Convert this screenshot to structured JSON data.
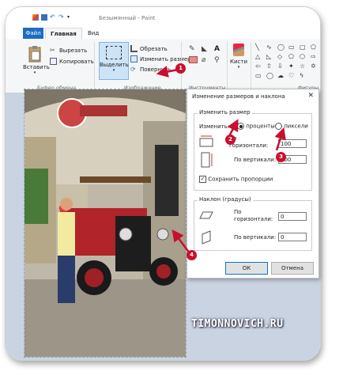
{
  "app": {
    "title": "Безымянный - Paint"
  },
  "menu": {
    "file": "Файл",
    "home": "Главная",
    "view": "Вид"
  },
  "clipboard": {
    "paste": "Вставить",
    "cut": "Вырезать",
    "copy": "Копировать",
    "label": "Буфер обмена"
  },
  "image_group": {
    "select": "Выделить",
    "crop": "Обрезать",
    "resize": "Изменить размер",
    "rotate": "Повернуть",
    "label": "Изображение"
  },
  "tools_group": {
    "label": "Инструменты"
  },
  "brushes": {
    "label": "Кисти"
  },
  "shapes": {
    "label": "Фигуры"
  },
  "dialog": {
    "title": "Изменение размеров и наклона",
    "resize_section": "Изменить размер",
    "by_label": "Изменить:",
    "percent_option": "проценты",
    "pixels_option": "пиксели",
    "selected": "проценты",
    "horizontal_label": "По горизонтали:",
    "horizontal_value": "100",
    "vertical_label": "По вертикали:",
    "vertical_value": "100",
    "keep_ratio": "Сохранить пропорции",
    "keep_ratio_checked": true,
    "skew_section": "Наклон (градусы)",
    "skew_horizontal_label": "По горизонтали:",
    "skew_horizontal_value": "0",
    "skew_vertical_label": "По вертикали:",
    "skew_vertical_value": "0",
    "ok": "ОК",
    "cancel": "Отмена"
  },
  "badges": [
    "1",
    "2",
    "3",
    "4"
  ],
  "watermark": "TIMONNOVICH.RU",
  "colors": {
    "accent": "#1e6cc4",
    "badge": "#c8102e",
    "arrow": "#c8102e"
  }
}
